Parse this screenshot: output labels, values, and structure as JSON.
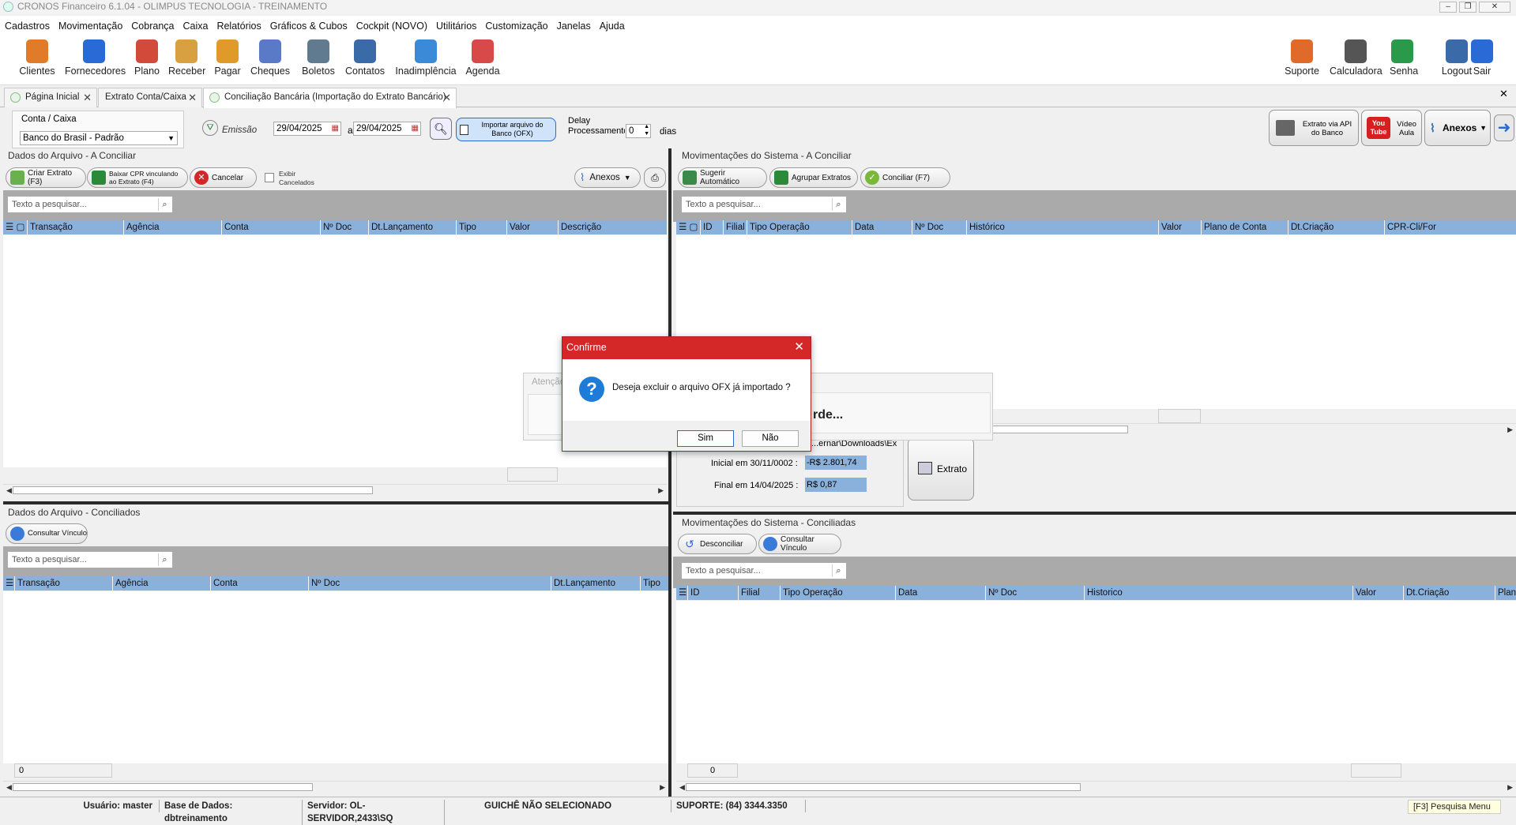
{
  "window": {
    "title": "CRONOS Financeiro 6.1.04 - OLIMPUS TECNOLOGIA - TREINAMENTO"
  },
  "menu": [
    "Cadastros",
    "Movimentação",
    "Cobrança",
    "Caixa",
    "Relatórios",
    "Gráficos & Cubos",
    "Cockpit (NOVO)",
    "Utilitários",
    "Customização",
    "Janelas",
    "Ajuda"
  ],
  "toolbar": {
    "left": [
      {
        "label": "Clientes",
        "icon": "clients-icon",
        "color": "#e07b2a"
      },
      {
        "label": "Fornecedores",
        "icon": "suppliers-icon",
        "color": "#2a6ad6"
      },
      {
        "label": "Plano",
        "icon": "plan-icon",
        "color": "#d24a3a"
      },
      {
        "label": "Receber",
        "icon": "receive-icon",
        "color": "#d8a040"
      },
      {
        "label": "Pagar",
        "icon": "pay-icon",
        "color": "#e09a2a"
      },
      {
        "label": "Cheques",
        "icon": "cheques-icon",
        "color": "#5a7ac8"
      },
      {
        "label": "Boletos",
        "icon": "boletos-icon",
        "color": "#607a90"
      },
      {
        "label": "Contatos",
        "icon": "contacts-icon",
        "color": "#3a6aa8"
      },
      {
        "label": "Inadimplência",
        "icon": "default-icon",
        "color": "#3a8ad8"
      },
      {
        "label": "Agenda",
        "icon": "calendar-icon",
        "color": "#d84a4a"
      }
    ],
    "right": [
      {
        "label": "Suporte",
        "icon": "support-icon",
        "color": "#e06a2a"
      },
      {
        "label": "Calculadora",
        "icon": "calculator-icon",
        "color": "#555555"
      },
      {
        "label": "Senha",
        "icon": "lock-icon",
        "color": "#2a9a4a"
      },
      {
        "label": "Logout",
        "icon": "logout-icon",
        "color": "#3a6aa8"
      },
      {
        "label": "Sair",
        "icon": "exit-icon",
        "color": "#2a6ad6"
      }
    ]
  },
  "tabs": [
    {
      "label": "Página Inicial"
    },
    {
      "label": "Extrato Conta/Caixa"
    },
    {
      "label": "Conciliação Bancária (Importação do Extrato Bancário)"
    }
  ],
  "filter": {
    "account_label": "Conta / Caixa",
    "account_value": "Banco do Brasil - Padrão",
    "emissao_label": "Emissão",
    "date_from": "29/04/2025",
    "date_sep": "a",
    "date_to": "29/04/2025",
    "import_button": "Importar arquivo do Banco (OFX)",
    "delay_label": "Delay Processamento",
    "delay_value": "0",
    "days_label": "dias",
    "api_button": "Extrato via API do Banco",
    "video_button": "Vídeo Aula",
    "youtube_label": "You Tube",
    "anexos_button": "Anexos"
  },
  "left_top": {
    "title": "Dados do Arquivo - A Conciliar",
    "btn_create": "Criar Extrato (F3)",
    "btn_baixar": "Baixar CPR vinculando ao Extrato (F4)",
    "btn_cancel": "Cancelar",
    "show_cancelled": "Exibir Cancelados",
    "anexos": "Anexos",
    "search_placeholder": "Texto a pesquisar...",
    "columns": [
      "Transação",
      "Agência",
      "Conta",
      "Nº Doc",
      "Dt.Lançamento",
      "Tipo",
      "Valor",
      "Descrição"
    ]
  },
  "right_top": {
    "title": "Movimentações do Sistema - A Conciliar",
    "btn_suggest": "Sugerir Automático",
    "btn_group": "Agrupar Extratos",
    "btn_reconcile": "Conciliar (F7)",
    "search_placeholder": "Texto a pesquisar...",
    "columns": [
      "ID",
      "Filial",
      "Tipo Operação",
      "Data",
      "Nº Doc",
      "Histórico",
      "Valor",
      "Plano de Conta",
      "Dt.Criação",
      "CPR-Cli/For"
    ]
  },
  "info": {
    "path": "...ernar\\Downloads\\Ex",
    "inicial_label": "Inicial em 30/11/0002 :",
    "inicial_value": "-R$ 2.801,74",
    "final_label": "Final em 14/04/2025 :",
    "final_value": "R$ 0,87",
    "extrato_button": "Extrato"
  },
  "left_bottom": {
    "title": "Dados do Arquivo - Conciliados",
    "btn_consult": "Consultar Vínculo",
    "search_placeholder": "Texto a pesquisar...",
    "columns": [
      "Transação",
      "Agência",
      "Conta",
      "Nº Doc",
      "Dt.Lançamento",
      "Tipo"
    ],
    "footer_count": "0"
  },
  "right_bottom": {
    "title": "Movimentações do Sistema - Conciliadas",
    "btn_unreconcile": "Desconciliar",
    "btn_consult": "Consultar Vínculo",
    "search_placeholder": "Texto a pesquisar...",
    "columns": [
      "ID",
      "Filial",
      "Tipo Operação",
      "Data",
      "Nº Doc",
      "Historico",
      "Valor",
      "Dt.Criação",
      "Plano"
    ],
    "footer_count": "0"
  },
  "background_dialogs": {
    "atencao_title": "Atenção",
    "wait_text": "rde..."
  },
  "dialog": {
    "title": "Confirme",
    "message": "Deseja excluir o arquivo OFX já importado ?",
    "yes": "Sim",
    "no": "Não"
  },
  "status": {
    "user": "Usuário: master",
    "db": "Base de Dados: dbtreinamento",
    "server": "Servidor: OL-SERVIDOR,2433\\SQ",
    "guiche": "GUICHÊ NÃO SELECIONADO",
    "support": "SUPORTE: (84) 3344.3350",
    "hint": "[F3] Pesquisa Menu"
  }
}
